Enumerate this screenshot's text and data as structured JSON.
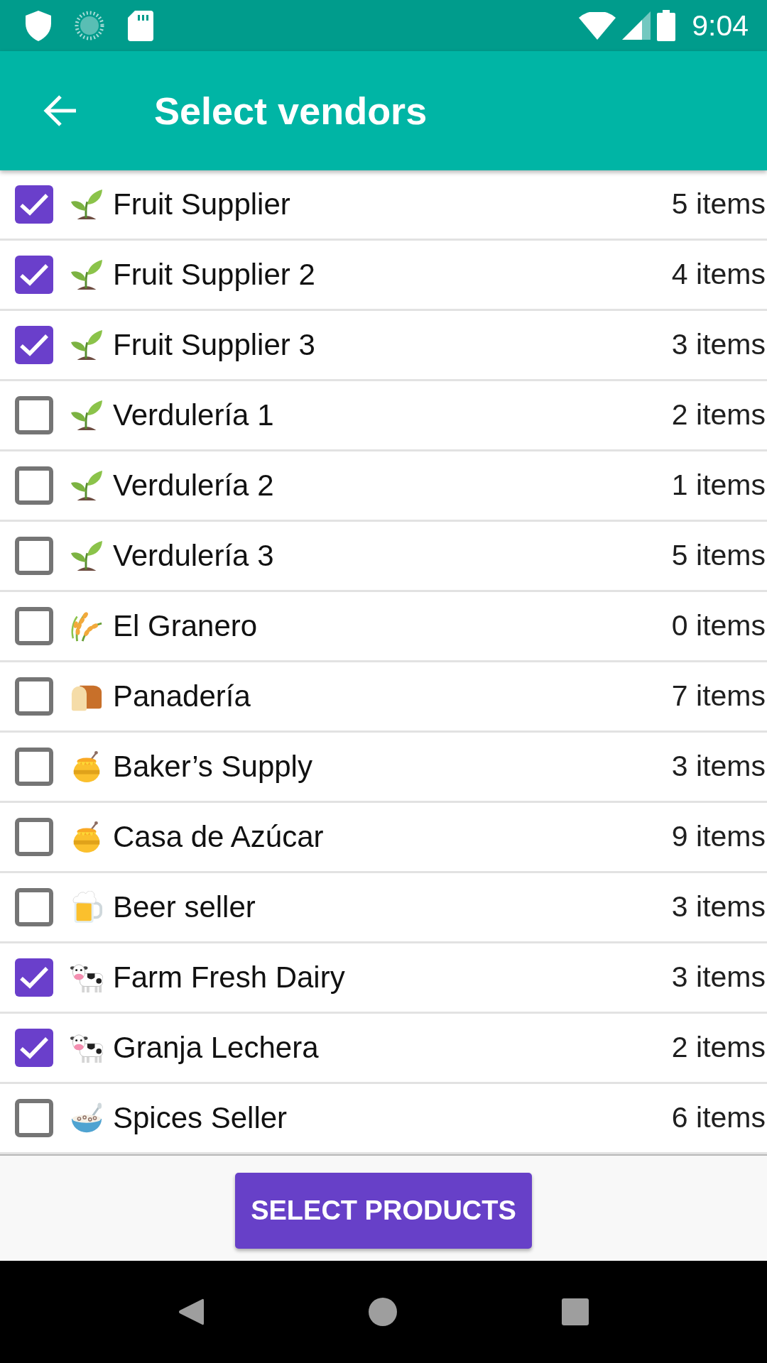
{
  "status_bar": {
    "time": "9:04"
  },
  "app_bar": {
    "title": "Select vendors"
  },
  "vendors": [
    {
      "kind": "seedling",
      "name": "Fruit Supplier",
      "count": "5 items",
      "checked": true
    },
    {
      "kind": "seedling",
      "name": "Fruit Supplier 2",
      "count": "4 items",
      "checked": true
    },
    {
      "kind": "seedling",
      "name": "Fruit Supplier 3",
      "count": "3 items",
      "checked": true
    },
    {
      "kind": "seedling",
      "name": "Verdulería 1",
      "count": "2 items",
      "checked": false
    },
    {
      "kind": "seedling",
      "name": "Verdulería 2",
      "count": "1 items",
      "checked": false
    },
    {
      "kind": "seedling",
      "name": "Verdulería 3",
      "count": "5 items",
      "checked": false
    },
    {
      "kind": "wheat",
      "name": "El Granero",
      "count": "0 items",
      "checked": false
    },
    {
      "kind": "bread",
      "name": "Panadería",
      "count": "7 items",
      "checked": false
    },
    {
      "kind": "honey",
      "name": "Baker’s Supply",
      "count": "3 items",
      "checked": false
    },
    {
      "kind": "honey",
      "name": "Casa de Azúcar",
      "count": "9 items",
      "checked": false
    },
    {
      "kind": "beer",
      "name": "Beer seller",
      "count": "3 items",
      "checked": false
    },
    {
      "kind": "cow",
      "name": "Farm Fresh Dairy",
      "count": "3 items",
      "checked": true
    },
    {
      "kind": "cow",
      "name": "Granja Lechera",
      "count": "2 items",
      "checked": true
    },
    {
      "kind": "cereal",
      "name": "Spices Seller",
      "count": "6 items",
      "checked": false
    }
  ],
  "footer": {
    "button": "SELECT PRODUCTS"
  }
}
